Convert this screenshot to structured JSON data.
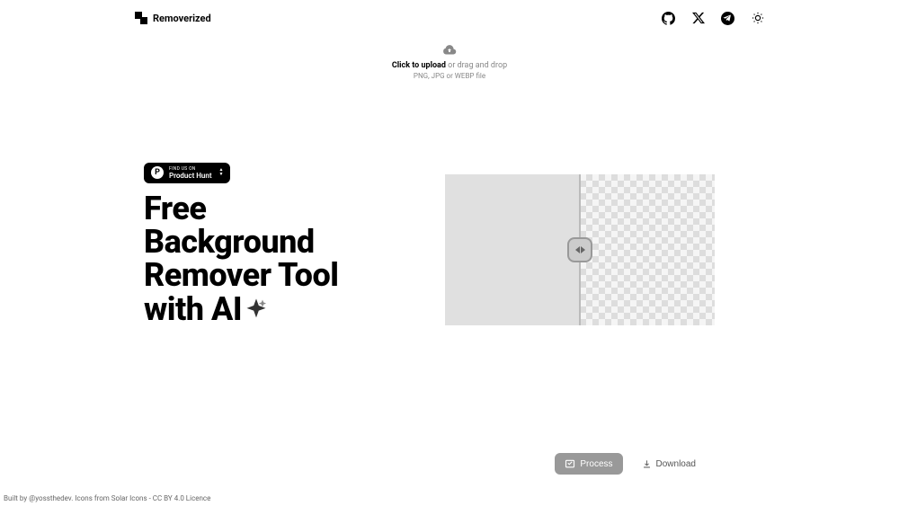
{
  "header": {
    "brand": "Removerized"
  },
  "upload": {
    "click_label": "Click to upload",
    "drag_label": " or drag and drop",
    "formats": "PNG, JPG or WEBP file"
  },
  "ph": {
    "label": "FIND US ON",
    "name": "Product Hunt"
  },
  "hero": {
    "headline": "Free Background Remover Tool with AI"
  },
  "actions": {
    "process": "Process",
    "download": "Download"
  },
  "footer": {
    "prefix": "Built by ",
    "author": "@yossthedev",
    "middle": ". Icons from ",
    "icons": "Solar Icons",
    "dash": " - ",
    "licence": "CC BY 4.0 Licence"
  }
}
